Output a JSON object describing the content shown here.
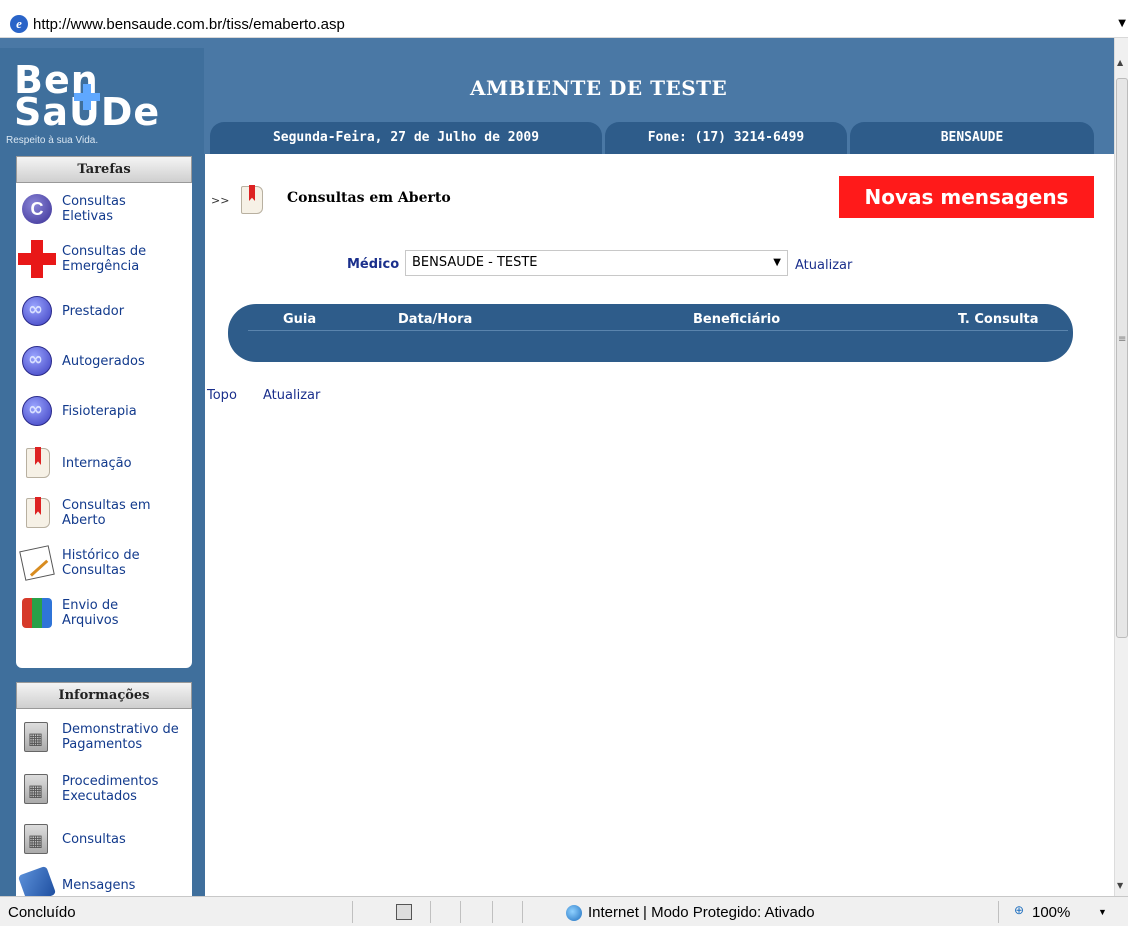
{
  "browser": {
    "url": "http://www.bensaude.com.br/tiss/emaberto.asp"
  },
  "header": {
    "logo_line1": "Ben",
    "logo_line2": "SaUDe",
    "slogan": "Respeito à sua Vida.",
    "title": "AMBIENTE DE TESTE",
    "date": "Segunda-Feira, 27 de Julho de 2009",
    "phone": "Fone: (17) 3214-6499",
    "user": "BENSAUDE"
  },
  "sidebar": {
    "tasks_title": "Tarefas",
    "tasks": [
      {
        "label": "Consultas Eletivas",
        "icon": "c-icon"
      },
      {
        "label": "Consultas de Emergência",
        "icon": "red-cross-icon"
      },
      {
        "label": "Prestador",
        "icon": "globe-icon"
      },
      {
        "label": "Autogerados",
        "icon": "globe-icon"
      },
      {
        "label": "Fisioterapia",
        "icon": "globe-icon"
      },
      {
        "label": "Internação",
        "icon": "book-icon"
      },
      {
        "label": "Consultas em Aberto",
        "icon": "book-icon"
      },
      {
        "label": "Histórico de Consultas",
        "icon": "document-icon"
      },
      {
        "label": "Envio de Arquivos",
        "icon": "blocks-icon"
      }
    ],
    "info_title": "Informações",
    "info": [
      {
        "label": "Demonstrativo de Pagamentos",
        "icon": "calculator-icon"
      },
      {
        "label": "Procedimentos Executados",
        "icon": "calculator-icon"
      },
      {
        "label": "Consultas",
        "icon": "calculator-icon"
      },
      {
        "label": "Mensagens",
        "icon": "mail-icon"
      }
    ]
  },
  "content": {
    "breadcrumb_arrow": ">>",
    "page_title": "Consultas em Aberto",
    "new_messages": "Novas mensagens",
    "medico_label": "Médico",
    "medico_value": "BENSAUDE - TESTE",
    "refresh": "Atualizar",
    "table_headers": [
      "Guia",
      "Data/Hora",
      "Beneficiário",
      "T. Consulta"
    ],
    "link_top": "Topo",
    "link_refresh": "Atualizar"
  },
  "statusbar": {
    "status": "Concluído",
    "zone": "Internet | Modo Protegido: Ativado",
    "zoom": "100%"
  },
  "colors": {
    "header_blue": "#4a78a5",
    "tab_blue": "#2e5c8a",
    "link_blue": "#1a2f8c",
    "alert_red": "#ff1a1a"
  }
}
